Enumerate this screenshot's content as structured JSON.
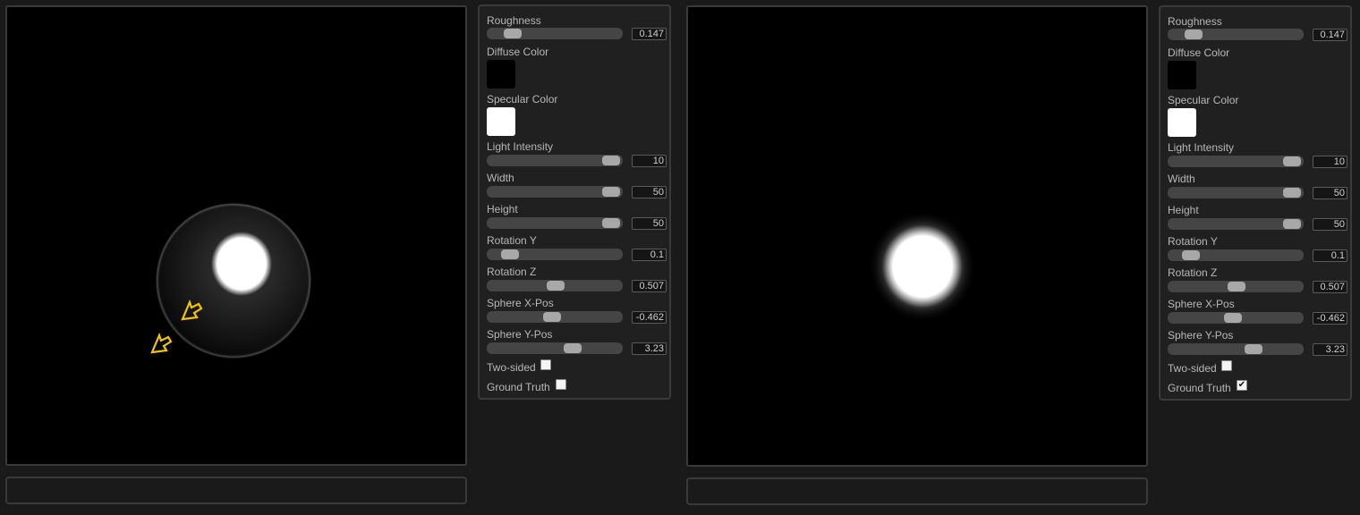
{
  "panels": [
    {
      "controls": {
        "roughness": {
          "label": "Roughness",
          "value": "0.147",
          "fraction": 0.13
        },
        "diffuse_color": {
          "label": "Diffuse Color",
          "color": "#000000"
        },
        "specular_color": {
          "label": "Specular Color",
          "color": "#ffffff"
        },
        "light_intensity": {
          "label": "Light Intensity",
          "value": "10",
          "fraction": 1.0
        },
        "width": {
          "label": "Width",
          "value": "50",
          "fraction": 1.0
        },
        "height": {
          "label": "Height",
          "value": "50",
          "fraction": 1.0
        },
        "rotation_y": {
          "label": "Rotation Y",
          "value": "0.1",
          "fraction": 0.1
        },
        "rotation_z": {
          "label": "Rotation Z",
          "value": "0.507",
          "fraction": 0.51
        },
        "sphere_x_pos": {
          "label": "Sphere X-Pos",
          "value": "-0.462",
          "fraction": 0.48
        },
        "sphere_y_pos": {
          "label": "Sphere Y-Pos",
          "value": "3.23",
          "fraction": 0.66
        },
        "two_sided": {
          "label": "Two-sided",
          "checked": false
        },
        "ground_truth": {
          "label": "Ground Truth",
          "checked": false
        }
      }
    },
    {
      "controls": {
        "roughness": {
          "label": "Roughness",
          "value": "0.147",
          "fraction": 0.13
        },
        "diffuse_color": {
          "label": "Diffuse Color",
          "color": "#000000"
        },
        "specular_color": {
          "label": "Specular Color",
          "color": "#ffffff"
        },
        "light_intensity": {
          "label": "Light Intensity",
          "value": "10",
          "fraction": 1.0
        },
        "width": {
          "label": "Width",
          "value": "50",
          "fraction": 1.0
        },
        "height": {
          "label": "Height",
          "value": "50",
          "fraction": 1.0
        },
        "rotation_y": {
          "label": "Rotation Y",
          "value": "0.1",
          "fraction": 0.1
        },
        "rotation_z": {
          "label": "Rotation Z",
          "value": "0.507",
          "fraction": 0.51
        },
        "sphere_x_pos": {
          "label": "Sphere X-Pos",
          "value": "-0.462",
          "fraction": 0.48
        },
        "sphere_y_pos": {
          "label": "Sphere Y-Pos",
          "value": "3.23",
          "fraction": 0.66
        },
        "two_sided": {
          "label": "Two-sided",
          "checked": false
        },
        "ground_truth": {
          "label": "Ground Truth",
          "checked": true
        }
      }
    }
  ],
  "annotations": {
    "arrow_color": "#f5c400"
  }
}
